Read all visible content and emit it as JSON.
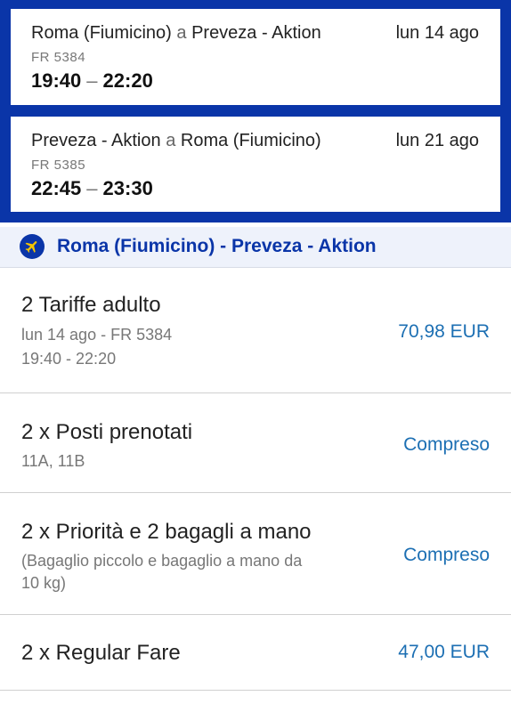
{
  "outbound": {
    "from": "Roma (Fiumicino)",
    "connector": "a",
    "to": "Preveza - Aktion",
    "date": "lun 14 ago",
    "code": "FR 5384",
    "depart": "19:40",
    "arrive": "22:20"
  },
  "return": {
    "from": "Preveza - Aktion",
    "connector": "a",
    "to": "Roma (Fiumicino)",
    "date": "lun 21 ago",
    "code": "FR 5385",
    "depart": "22:45",
    "arrive": "23:30"
  },
  "section": {
    "title": "Roma (Fiumicino) - Preveza - Aktion",
    "icon": "plane-icon"
  },
  "items": [
    {
      "title": "2 Tariffe adulto",
      "sub1": "lun 14 ago - FR 5384",
      "sub2": "19:40 - 22:20",
      "price": "70,98 EUR"
    },
    {
      "title": "2 x Posti prenotati",
      "sub1": "11A, 11B",
      "price": "Compreso"
    },
    {
      "title": "2 x Priorità e 2 bagagli a mano",
      "sub1": "(Bagaglio piccolo e bagaglio a mano da",
      "sub2": "10 kg)",
      "price": "Compreso"
    },
    {
      "title": "2 x Regular Fare",
      "price": "47,00 EUR"
    }
  ],
  "colors": {
    "brand": "#0a35a8",
    "price": "#1c6fb3"
  }
}
